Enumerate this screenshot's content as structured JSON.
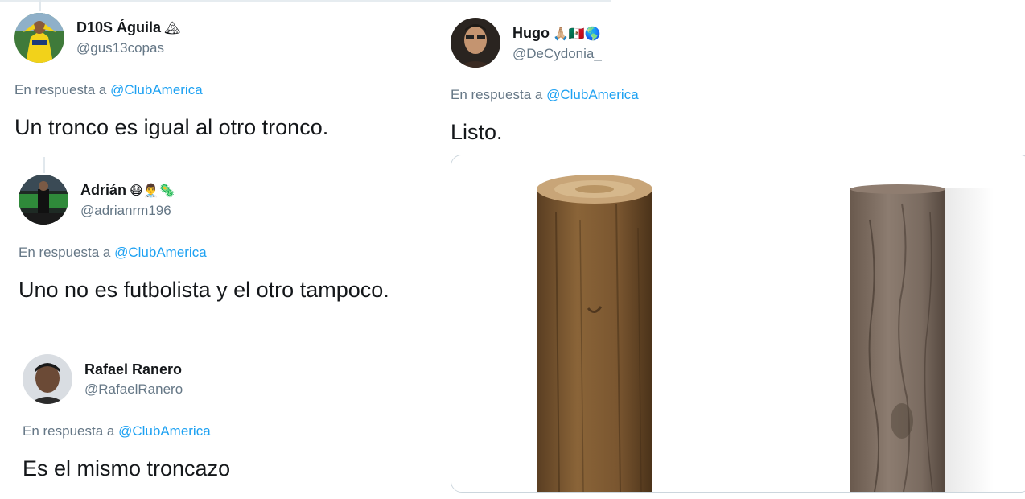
{
  "tweets": [
    {
      "name": "D10S Águila",
      "emoji": "🏔",
      "handle": "@gus13copas",
      "reply_prefix": "En respuesta a",
      "reply_mention": "@ClubAmerica",
      "text": "Un tronco es igual al otro tronco."
    },
    {
      "name": "Adrián",
      "emoji": "😷👨‍⚕️🦠",
      "handle": "@adrianrm196",
      "reply_prefix": "En respuesta a",
      "reply_mention": "@ClubAmerica",
      "text": "Uno no es futbolista y el otro tampoco."
    },
    {
      "name": "Rafael Ranero",
      "emoji": "",
      "handle": "@RafaelRanero",
      "reply_prefix": "En respuesta a",
      "reply_mention": "@ClubAmerica",
      "text": "Es el mismo troncazo"
    },
    {
      "name": "Hugo",
      "emoji": "🙏🏼🇲🇽🌎",
      "handle": "@DeCydonia_",
      "reply_prefix": "En respuesta a",
      "reply_mention": "@ClubAmerica",
      "text": "Listo."
    }
  ],
  "colors": {
    "mention": "#1da1f2",
    "secondary_text": "#657786",
    "primary_text": "#14171a"
  },
  "media_icons": [
    "wooden-log-photo",
    "tree-trunk-photo"
  ]
}
